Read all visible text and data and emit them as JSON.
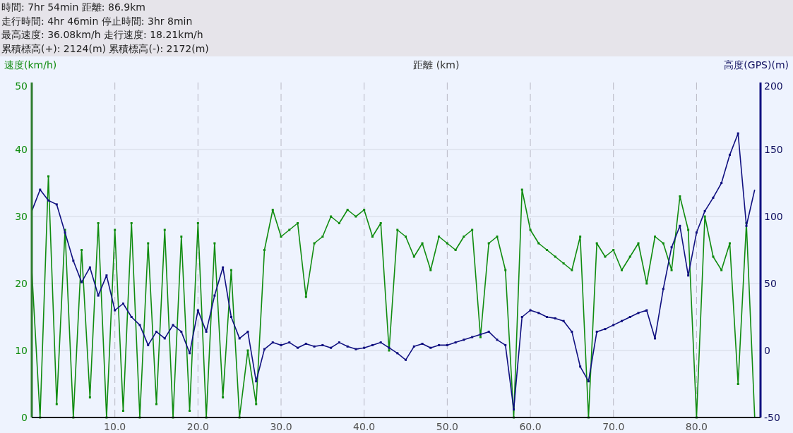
{
  "summary": [
    "時間: 7hr 54min 距離: 86.9km",
    "走行時間: 4hr 46min 停止時間: 3hr 8min",
    "最高速度: 36.08km/h 走行速度: 18.21km/h",
    "累積標高(+): 2124(m) 累積標高(-): 2172(m)"
  ],
  "chart": {
    "chart_data": {
      "type": "line",
      "xlabel": "距離 (km)",
      "xlim": [
        0,
        87.7
      ],
      "ylim": [
        0,
        50
      ],
      "xticks": [
        {
          "value": 10,
          "label": "10.0"
        },
        {
          "value": 20,
          "label": "20.0"
        },
        {
          "value": 30,
          "label": "30.0"
        },
        {
          "value": 40,
          "label": "40.0"
        },
        {
          "value": 50,
          "label": "50.0"
        },
        {
          "value": 60,
          "label": "60.0"
        },
        {
          "value": 70,
          "label": "70.0"
        },
        {
          "value": 80,
          "label": "80.0"
        }
      ],
      "yticks": [
        0,
        10,
        20,
        30,
        40,
        50
      ],
      "grid": true,
      "x": [
        0,
        1,
        2,
        3,
        4,
        5,
        6,
        7,
        8,
        9,
        10,
        11,
        12,
        13,
        14,
        15,
        16,
        17,
        18,
        19,
        20,
        21,
        22,
        23,
        24,
        25,
        26,
        27,
        28,
        29,
        30,
        31,
        32,
        33,
        34,
        35,
        36,
        37,
        38,
        39,
        40,
        41,
        42,
        43,
        44,
        45,
        46,
        47,
        48,
        49,
        50,
        51,
        52,
        53,
        54,
        55,
        56,
        57,
        58,
        59,
        60,
        61,
        62,
        63,
        64,
        65,
        66,
        67,
        68,
        69,
        70,
        71,
        72,
        73,
        74,
        75,
        76,
        77,
        78,
        79,
        80,
        81,
        82,
        83,
        84,
        85,
        86,
        87
      ],
      "series": [
        {
          "name": "速度(km/h)",
          "color": "#108c10",
          "values": [
            22,
            0,
            36,
            2,
            28,
            0,
            25,
            3,
            29,
            0,
            28,
            1,
            29,
            0,
            26,
            2,
            28,
            0,
            27,
            1,
            29,
            0,
            26,
            3,
            22,
            0,
            10,
            2,
            25,
            31,
            27,
            28,
            29,
            18,
            26,
            27,
            30,
            29,
            31,
            30,
            31,
            27,
            29,
            10,
            28,
            27,
            24,
            26,
            22,
            27,
            26,
            25,
            27,
            28,
            12,
            26,
            27,
            22,
            0,
            34,
            28,
            26,
            25,
            24,
            23,
            22,
            27,
            0,
            26,
            24,
            25,
            22,
            24,
            26,
            20,
            27,
            26,
            22,
            33,
            28,
            0,
            30,
            24,
            22,
            26,
            5,
            29,
            0
          ]
        },
        {
          "name": "高度(GPS)(m)",
          "color": "#101080",
          "axis": "y2",
          "values": [
            104,
            120,
            112,
            109,
            88,
            67,
            51,
            62,
            41,
            56,
            30,
            35,
            25,
            19,
            4,
            14,
            9,
            19,
            14,
            -2,
            30,
            14,
            41,
            62,
            25,
            9,
            14,
            -23,
            1,
            6,
            4,
            6,
            2,
            5,
            3,
            4,
            2,
            6,
            3,
            1,
            2,
            4,
            6,
            2,
            -2,
            -7,
            3,
            5,
            2,
            4,
            4,
            6,
            8,
            10,
            12,
            14,
            8,
            4,
            -44,
            25,
            30,
            28,
            25,
            24,
            22,
            14,
            -12,
            -23,
            14,
            16,
            19,
            22,
            25,
            28,
            30,
            9,
            46,
            77,
            93,
            56,
            88,
            104,
            114,
            125,
            146,
            162,
            93,
            120
          ]
        }
      ],
      "y2lim": [
        -50,
        200
      ],
      "y2ticks": [
        {
          "value": 200,
          "label": "200"
        },
        {
          "value": 150,
          "label": "150"
        },
        {
          "value": 100,
          "label": "100"
        },
        {
          "value": 50,
          "label": "50"
        },
        {
          "value": 0,
          "label": "0"
        },
        {
          "value": -50,
          "label": "-50"
        }
      ]
    }
  }
}
